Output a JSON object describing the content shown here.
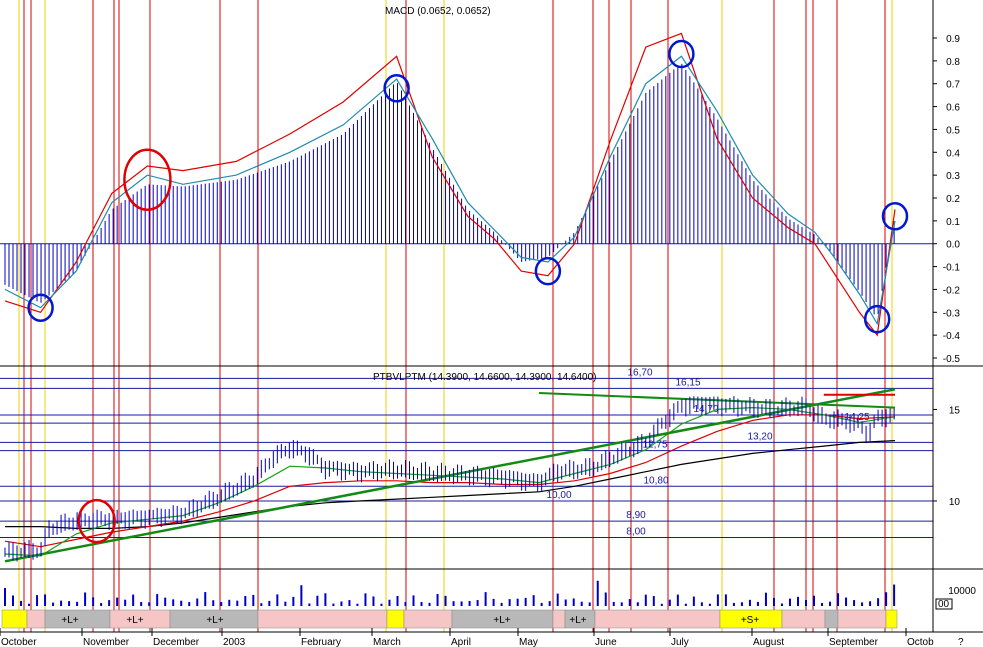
{
  "colors": {
    "macd_line": "#0000c0",
    "signal_line": "#e00000",
    "trend_line": "#138a13",
    "level_line": "#1a1aa0",
    "long_ma": "#000000",
    "mid_ma": "#e00000",
    "short_ma": "#16a016",
    "vline_red": "#d40000",
    "vline_yellow": "#e8d400",
    "circle_red": "#e00000",
    "circle_blue": "#0018d0",
    "band_yellow": "#ffff00",
    "band_gray": "#b8b8b8",
    "band_pink": "#f6c6c6"
  },
  "chart_data": [
    {
      "type": "bar",
      "name": "macd_panel",
      "title": "MACD (0.0652, 0.0652)",
      "ylim": [
        -0.5,
        1.0
      ],
      "y_ticks": [
        "0.9",
        "0.8",
        "0.7",
        "0.6",
        "0.5",
        "0.4",
        "0.3",
        "0.2",
        "0.1",
        "0.0",
        "-0.1",
        "-0.2",
        "-0.3",
        "-0.4",
        "-0.5"
      ],
      "x_range": [
        0,
        100
      ],
      "histogram": [
        [
          0,
          -0.18
        ],
        [
          4,
          -0.26
        ],
        [
          8,
          -0.12
        ],
        [
          12,
          0.15
        ],
        [
          16,
          0.26
        ],
        [
          20,
          0.25
        ],
        [
          26,
          0.28
        ],
        [
          32,
          0.36
        ],
        [
          38,
          0.48
        ],
        [
          44,
          0.71
        ],
        [
          48,
          0.42
        ],
        [
          52,
          0.15
        ],
        [
          55,
          0.05
        ],
        [
          58,
          -0.08
        ],
        [
          61,
          -0.06
        ],
        [
          64,
          0.05
        ],
        [
          68,
          0.36
        ],
        [
          72,
          0.66
        ],
        [
          76,
          0.79
        ],
        [
          80,
          0.55
        ],
        [
          84,
          0.28
        ],
        [
          88,
          0.11
        ],
        [
          91,
          0.04
        ],
        [
          93,
          -0.05
        ],
        [
          96,
          -0.21
        ],
        [
          98,
          -0.33
        ],
        [
          100,
          0.12
        ]
      ],
      "macd_line": [
        [
          0,
          -0.2
        ],
        [
          4,
          -0.28
        ],
        [
          8,
          -0.12
        ],
        [
          12,
          0.18
        ],
        [
          16,
          0.3
        ],
        [
          20,
          0.26
        ],
        [
          26,
          0.3
        ],
        [
          32,
          0.4
        ],
        [
          38,
          0.52
        ],
        [
          44,
          0.72
        ],
        [
          48,
          0.46
        ],
        [
          52,
          0.18
        ],
        [
          55,
          0.06
        ],
        [
          58,
          -0.06
        ],
        [
          61,
          -0.08
        ],
        [
          64,
          0.03
        ],
        [
          68,
          0.38
        ],
        [
          72,
          0.7
        ],
        [
          76,
          0.82
        ],
        [
          80,
          0.58
        ],
        [
          84,
          0.3
        ],
        [
          88,
          0.13
        ],
        [
          91,
          0.05
        ],
        [
          93,
          -0.05
        ],
        [
          96,
          -0.22
        ],
        [
          98,
          -0.35
        ],
        [
          100,
          0.1
        ]
      ],
      "signal_line": [
        [
          0,
          -0.25
        ],
        [
          4,
          -0.3
        ],
        [
          8,
          -0.08
        ],
        [
          12,
          0.22
        ],
        [
          16,
          0.34
        ],
        [
          20,
          0.32
        ],
        [
          26,
          0.36
        ],
        [
          32,
          0.48
        ],
        [
          38,
          0.62
        ],
        [
          44,
          0.82
        ],
        [
          48,
          0.38
        ],
        [
          52,
          0.12
        ],
        [
          55,
          0.02
        ],
        [
          58,
          -0.12
        ],
        [
          61,
          -0.14
        ],
        [
          64,
          0.0
        ],
        [
          68,
          0.45
        ],
        [
          72,
          0.86
        ],
        [
          76,
          0.92
        ],
        [
          80,
          0.46
        ],
        [
          84,
          0.2
        ],
        [
          88,
          0.07
        ],
        [
          91,
          0.0
        ],
        [
          93,
          -0.12
        ],
        [
          96,
          -0.3
        ],
        [
          98,
          -0.4
        ],
        [
          100,
          0.15
        ]
      ],
      "circles": [
        {
          "color": "blue",
          "x": 4,
          "y": -0.28
        },
        {
          "color": "red",
          "x": 16,
          "y": 0.28
        },
        {
          "color": "blue",
          "x": 44,
          "y": 0.68
        },
        {
          "color": "blue",
          "x": 61,
          "y": -0.12
        },
        {
          "color": "blue",
          "x": 76,
          "y": 0.83
        },
        {
          "color": "blue",
          "x": 98,
          "y": -0.33
        },
        {
          "color": "blue",
          "x": 100,
          "y": 0.12
        }
      ]
    },
    {
      "type": "line",
      "name": "price_panel",
      "title": "PTBVLPTM (14.3900, 14.6600, 14.3900, 14.6400)",
      "ylim": [
        6.5,
        16.5
      ],
      "y_ticks": [
        "15",
        "10"
      ],
      "x_range": [
        0,
        100
      ],
      "price": [
        [
          0,
          7.2
        ],
        [
          4,
          7.3
        ],
        [
          5,
          8.5
        ],
        [
          8,
          8.9
        ],
        [
          12,
          9.0
        ],
        [
          16,
          9.1
        ],
        [
          20,
          9.3
        ],
        [
          24,
          10.2
        ],
        [
          28,
          11.2
        ],
        [
          30,
          12.3
        ],
        [
          32,
          12.9
        ],
        [
          34,
          12.6
        ],
        [
          36,
          11.8
        ],
        [
          40,
          11.6
        ],
        [
          44,
          11.7
        ],
        [
          48,
          11.5
        ],
        [
          52,
          11.4
        ],
        [
          56,
          11.3
        ],
        [
          60,
          11.0
        ],
        [
          62,
          11.6
        ],
        [
          66,
          11.8
        ],
        [
          68,
          12.3
        ],
        [
          72,
          13.2
        ],
        [
          74,
          14.3
        ],
        [
          76,
          15.2
        ],
        [
          78,
          15.3
        ],
        [
          82,
          15.2
        ],
        [
          86,
          15.0
        ],
        [
          90,
          15.1
        ],
        [
          92,
          14.5
        ],
        [
          94,
          14.4
        ],
        [
          96,
          14.2
        ],
        [
          97,
          13.6
        ],
        [
          98,
          14.6
        ],
        [
          100,
          14.64
        ]
      ],
      "ma_short": [
        [
          0,
          7.1
        ],
        [
          4,
          7.0
        ],
        [
          8,
          8.2
        ],
        [
          12,
          8.8
        ],
        [
          16,
          9.0
        ],
        [
          20,
          9.2
        ],
        [
          24,
          9.9
        ],
        [
          28,
          10.8
        ],
        [
          32,
          11.9
        ],
        [
          36,
          11.8
        ],
        [
          40,
          11.6
        ],
        [
          44,
          11.5
        ],
        [
          48,
          11.4
        ],
        [
          52,
          11.3
        ],
        [
          56,
          11.2
        ],
        [
          60,
          11.0
        ],
        [
          64,
          11.5
        ],
        [
          68,
          12.0
        ],
        [
          72,
          12.8
        ],
        [
          76,
          14.2
        ],
        [
          80,
          15.0
        ],
        [
          84,
          15.1
        ],
        [
          88,
          15.0
        ],
        [
          92,
          14.7
        ],
        [
          96,
          14.3
        ],
        [
          100,
          14.6
        ]
      ],
      "ma_mid": [
        [
          0,
          7.8
        ],
        [
          4,
          7.5
        ],
        [
          8,
          7.9
        ],
        [
          12,
          8.3
        ],
        [
          16,
          8.6
        ],
        [
          20,
          8.9
        ],
        [
          24,
          9.4
        ],
        [
          28,
          10.0
        ],
        [
          32,
          10.8
        ],
        [
          36,
          11.0
        ],
        [
          40,
          11.1
        ],
        [
          44,
          11.1
        ],
        [
          48,
          11.0
        ],
        [
          52,
          11.0
        ],
        [
          56,
          10.9
        ],
        [
          60,
          10.9
        ],
        [
          64,
          11.1
        ],
        [
          68,
          11.5
        ],
        [
          72,
          12.1
        ],
        [
          76,
          13.0
        ],
        [
          80,
          13.8
        ],
        [
          84,
          14.4
        ],
        [
          88,
          14.7
        ],
        [
          92,
          14.7
        ],
        [
          96,
          14.5
        ],
        [
          100,
          14.6
        ]
      ],
      "ma_long": [
        [
          0,
          8.6
        ],
        [
          4,
          8.6
        ],
        [
          8,
          8.5
        ],
        [
          12,
          8.5
        ],
        [
          16,
          8.6
        ],
        [
          20,
          8.8
        ],
        [
          24,
          9.1
        ],
        [
          28,
          9.4
        ],
        [
          32,
          9.7
        ],
        [
          36,
          9.9
        ],
        [
          40,
          10.0
        ],
        [
          44,
          10.1
        ],
        [
          48,
          10.2
        ],
        [
          52,
          10.3
        ],
        [
          56,
          10.4
        ],
        [
          60,
          10.5
        ],
        [
          64,
          10.8
        ],
        [
          68,
          11.2
        ],
        [
          72,
          11.6
        ],
        [
          76,
          12.0
        ],
        [
          80,
          12.3
        ],
        [
          84,
          12.6
        ],
        [
          88,
          12.8
        ],
        [
          92,
          13.0
        ],
        [
          96,
          13.2
        ],
        [
          100,
          13.3
        ]
      ],
      "trend_up": [
        [
          0,
          6.7
        ],
        [
          100,
          16.1
        ]
      ],
      "trend_down": [
        [
          60,
          15.9
        ],
        [
          100,
          15.1
        ]
      ],
      "resistance_red": [
        [
          92,
          15.8
        ],
        [
          100,
          15.8
        ]
      ],
      "levels": [
        {
          "y": 16.7,
          "label": "16,70"
        },
        {
          "y": 16.15,
          "label": "16,15"
        },
        {
          "y": 14.7,
          "label": "14,70"
        },
        {
          "y": 14.25,
          "label": "14,25"
        },
        {
          "y": 13.2,
          "label": "13,20"
        },
        {
          "y": 12.75,
          "label": "12,75"
        },
        {
          "y": 10.8,
          "label": "10,80"
        },
        {
          "y": 10.0,
          "label": "10,00"
        },
        {
          "y": 8.9,
          "label": "8,90"
        },
        {
          "y": 8.0,
          "label": "8,00"
        }
      ]
    },
    {
      "type": "bar",
      "name": "volume_panel",
      "y_ticks": [
        "10000",
        "00"
      ],
      "ylim": [
        0,
        14000
      ]
    }
  ],
  "x_axis": {
    "months": [
      "October",
      "November",
      "December",
      "2003",
      "February",
      "March",
      "April",
      "May",
      "June",
      "July",
      "August",
      "September",
      "Octob"
    ],
    "corner": "?"
  },
  "signal_strip": {
    "labels": [
      "+L+",
      "+L+",
      "+L+",
      "+L+",
      "+L+",
      "+S+"
    ]
  }
}
